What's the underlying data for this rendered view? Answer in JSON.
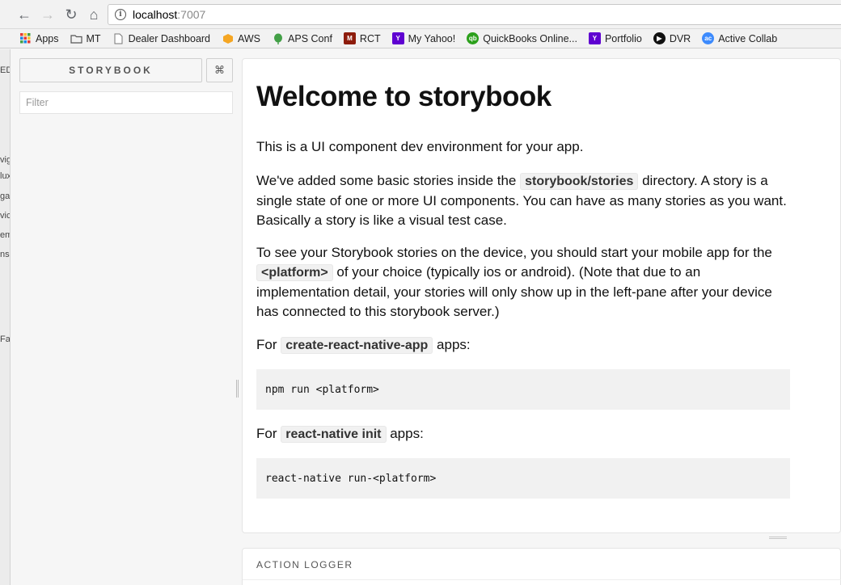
{
  "browser": {
    "url_host": "localhost",
    "url_port": ":7007",
    "nav": {
      "back": "←",
      "forward": "→",
      "reload": "↻",
      "home": "⌂",
      "info": "i"
    },
    "bookmarks": [
      {
        "label": "Apps",
        "icon": "apps-grid-icon",
        "color": "#e53935"
      },
      {
        "label": "MT",
        "icon": "folder-icon",
        "color": "#666666"
      },
      {
        "label": "Dealer Dashboard",
        "icon": "page-icon",
        "color": "#888888"
      },
      {
        "label": "AWS",
        "icon": "aws-cube-icon",
        "color": "#f5a623"
      },
      {
        "label": "APS Conf",
        "icon": "leaf-icon",
        "color": "#43a047"
      },
      {
        "label": "RCT",
        "icon": "m-logo-icon",
        "color": "#8d1c0c"
      },
      {
        "label": "My Yahoo!",
        "icon": "yahoo-icon",
        "color": "#5f01d1"
      },
      {
        "label": "QuickBooks Online...",
        "icon": "quickbooks-icon",
        "color": "#2ca01c"
      },
      {
        "label": "Portfolio",
        "icon": "yahoo-icon",
        "color": "#5f01d1"
      },
      {
        "label": "DVR",
        "icon": "play-circle-icon",
        "color": "#111111"
      },
      {
        "label": "Active Collab",
        "icon": "active-collab-icon",
        "color": "#3d8bfd"
      }
    ]
  },
  "strip": [
    "ED",
    "vig",
    "lux",
    "gas",
    "vic",
    "em",
    "ns",
    "Fa"
  ],
  "sidebar": {
    "brand": "STORYBOOK",
    "shortcut_icon": "⌘",
    "filter_placeholder": "Filter"
  },
  "welcome": {
    "title": "Welcome to storybook",
    "intro": "This is a UI component dev environment for your app.",
    "p2_before": "We've added some basic stories inside the ",
    "p2_code": "storybook/stories",
    "p2_after": " directory. A story is a single state of one or more UI components. You can have as many stories as you want. Basically a story is like a visual test case.",
    "p3_before": "To see your Storybook stories on the device, you should start your mobile app for the ",
    "p3_code": "<platform>",
    "p3_after": " of your choice (typically ios or android). (Note that due to an implementation detail, your stories will only show up in the left-pane after your device has connected to this storybook server.)",
    "p4_before": "For ",
    "p4_code": "create-react-native-app",
    "p4_after": " apps:",
    "code1": "npm run <platform>",
    "p5_before": "For ",
    "p5_code": "react-native init",
    "p5_after": " apps:",
    "code2": "react-native run-<platform>"
  },
  "addon": {
    "tab": "ACTION LOGGER"
  }
}
